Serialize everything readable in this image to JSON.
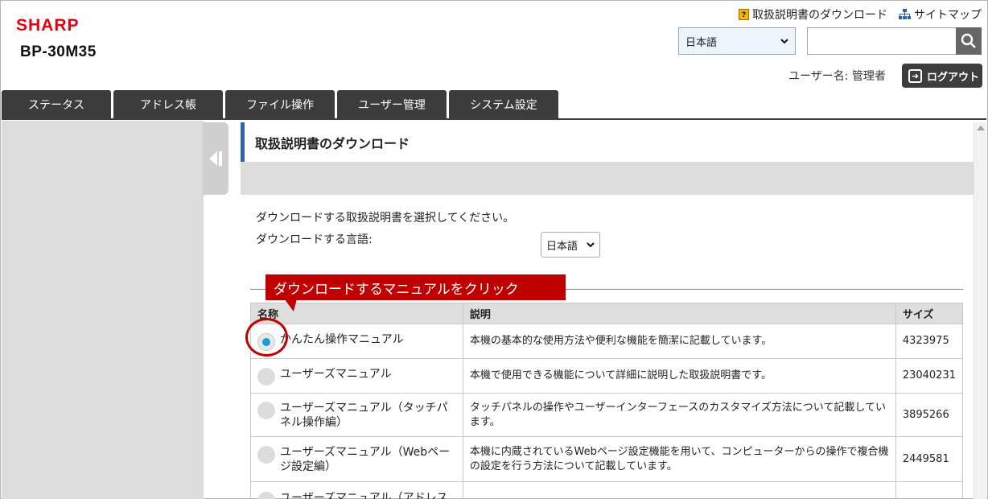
{
  "header": {
    "logo_text": "SHARP",
    "model": "BP-30M35",
    "links": {
      "manual_download": "取扱説明書のダウンロード",
      "sitemap": "サイトマップ"
    },
    "language_select": "日本語",
    "search_placeholder": "",
    "user_label": "ユーザー名: 管理者",
    "logout": "ログアウト"
  },
  "tabs": [
    "ステータス",
    "アドレス帳",
    "ファイル操作",
    "ユーザー管理",
    "システム設定"
  ],
  "page": {
    "title": "取扱説明書のダウンロード",
    "instruction": "ダウンロードする取扱説明書を選択してください。",
    "language_label": "ダウンロードする言語:",
    "language_value": "日本語",
    "callout": "ダウンロードするマニュアルをクリック"
  },
  "table": {
    "headers": {
      "name": "名称",
      "description": "説明",
      "size": "サイズ"
    },
    "rows": [
      {
        "name": "かんたん操作マニュアル",
        "description": "本機の基本的な使用方法や便利な機能を簡潔に記載しています。",
        "size": "4323975",
        "selected": true
      },
      {
        "name": "ユーザーズマニュアル",
        "description": "本機で使用できる機能について詳細に説明した取扱説明書です。",
        "size": "23040231",
        "selected": false
      },
      {
        "name": "ユーザーズマニュアル（タッチパネル操作編）",
        "description": "タッチパネルの操作やユーザーインターフェースのカスタマイズ方法について記載しています。",
        "size": "3895266",
        "selected": false
      },
      {
        "name": "ユーザーズマニュアル（Webページ設定編）",
        "description": "本機に内蔵されているWebページ設定機能を用いて、コンピューターからの操作で複合機の設定を行う方法について記載しています。",
        "size": "2449581",
        "selected": false
      },
      {
        "name": "ユーザーズマニュアル（アドレス",
        "description": "",
        "size": "",
        "selected": false
      }
    ]
  },
  "colors": {
    "brand": "#e60012",
    "accent_blue": "#2f64ad",
    "callout": "#c00000",
    "radio_on": "#1d9bd6"
  },
  "icons": [
    "manual-icon",
    "sitemap-icon",
    "search-icon",
    "logout-icon",
    "collapse-icon",
    "chevron-down-icon"
  ]
}
